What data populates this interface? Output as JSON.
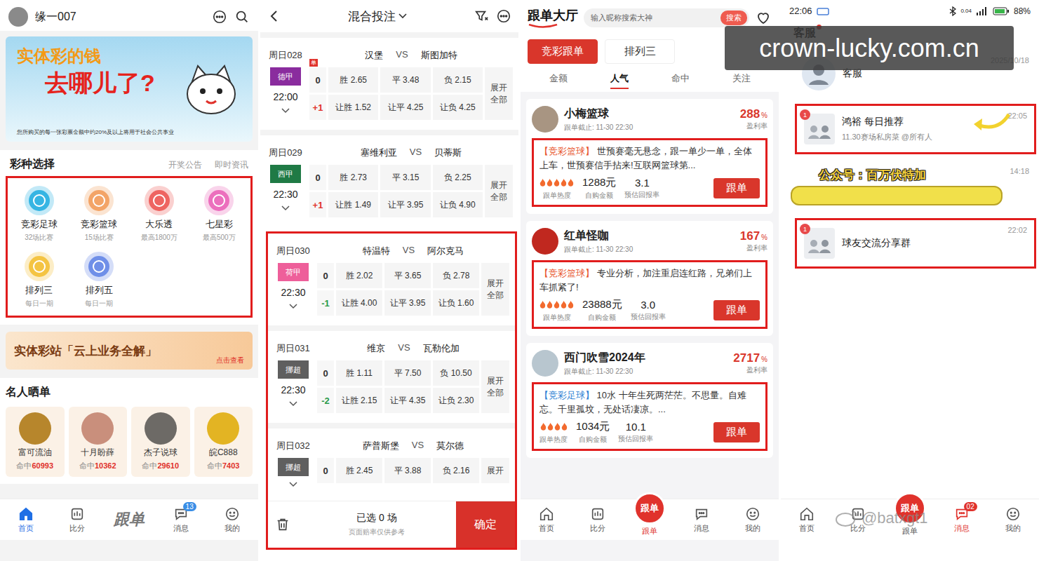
{
  "home": {
    "user": "缘一007",
    "banner": {
      "title1": "实体彩的钱",
      "title2": "去哪儿了?",
      "caption": "您所购买的每一张彩票金额中约20%及以上将用于社会公共事业"
    },
    "lottery": {
      "title": "彩种选择",
      "links": [
        "开奖公告",
        "即时资讯"
      ],
      "boxed": true,
      "items": [
        {
          "name": "竞彩足球",
          "sub": "32场比赛",
          "color": "#36b5e3"
        },
        {
          "name": "竞彩篮球",
          "sub": "15场比赛",
          "color": "#f3a467"
        },
        {
          "name": "大乐透",
          "sub": "最高1800万",
          "color": "#ee6461"
        },
        {
          "name": "七星彩",
          "sub": "最高500万",
          "color": "#ec6fbd"
        },
        {
          "name": "排列三",
          "sub": "每日一期",
          "color": "#f4c443"
        },
        {
          "name": "排列五",
          "sub": "每日一期",
          "color": "#6f8fe8"
        }
      ]
    },
    "promo": {
      "title": "实体彩站「云上业务全解」",
      "link": "点击查看"
    },
    "celebs": {
      "title": "名人晒单",
      "items": [
        {
          "name": "富可流油",
          "hits_label": "命中",
          "hits": "60993",
          "color": "#b7862c"
        },
        {
          "name": "十月盼薛",
          "hits_label": "命中",
          "hits": "10362",
          "color": "#c98f7c"
        },
        {
          "name": "杰子说球",
          "hits_label": "命中",
          "hits": "29610",
          "color": "#6d6a66"
        },
        {
          "name": "皖C888",
          "hits_label": "命中",
          "hits": "7403",
          "color": "#e3b423"
        }
      ]
    },
    "nav": [
      {
        "kind": "home",
        "label": "首页",
        "selected": true
      },
      {
        "kind": "score",
        "label": "比分",
        "selected": false
      },
      {
        "kind": "center-plain",
        "logo": "跟单",
        "selected": false
      },
      {
        "kind": "message",
        "label": "消息",
        "badge": "13",
        "selected": false
      },
      {
        "kind": "me",
        "label": "我的",
        "selected": false
      }
    ]
  },
  "betting": {
    "title": "混合投注",
    "matches": [
      {
        "code": "周日028",
        "league": "德甲",
        "color": "#8a2c9e",
        "time": "22:00",
        "home": "汉堡",
        "vs": "VS",
        "away": "斯图加特",
        "single": "单",
        "boxed": false,
        "expand": "展开全部",
        "rows": [
          {
            "handicap": "0",
            "odds": [
              "胜 2.65",
              "平 3.48",
              "负 2.15"
            ]
          },
          {
            "handicap": "+1",
            "odds": [
              "让胜 1.52",
              "让平 4.25",
              "让负 4.25"
            ]
          }
        ]
      },
      {
        "code": "周日029",
        "league": "西甲",
        "color": "#1f7a45",
        "time": "22:30",
        "home": "塞维利亚",
        "vs": "VS",
        "away": "贝蒂斯",
        "boxed": false,
        "expand": "展开全部",
        "rows": [
          {
            "handicap": "0",
            "odds": [
              "胜 2.73",
              "平 3.15",
              "负 2.25"
            ]
          },
          {
            "handicap": "+1",
            "odds": [
              "让胜 1.49",
              "让平 3.95",
              "让负 4.90"
            ]
          }
        ]
      },
      {
        "code": "周日030",
        "league": "荷甲",
        "color": "#ee5f9a",
        "time": "22:30",
        "home": "特温特",
        "vs": "VS",
        "away": "阿尔克马",
        "boxed": true,
        "expand": "展开全部",
        "rows": [
          {
            "handicap": "0",
            "odds": [
              "胜 2.02",
              "平 3.65",
              "负 2.78"
            ]
          },
          {
            "handicap": "-1",
            "odds": [
              "让胜 4.00",
              "让平 3.95",
              "让负 1.60"
            ]
          }
        ]
      },
      {
        "code": "周日031",
        "league": "挪超",
        "color": "#5f5f5f",
        "time": "22:30",
        "home": "维京",
        "vs": "VS",
        "away": "瓦勒伦加",
        "boxed": true,
        "expand": "展开全部",
        "rows": [
          {
            "handicap": "0",
            "odds": [
              "胜 1.11",
              "平 7.50",
              "负 10.50"
            ]
          },
          {
            "handicap": "-2",
            "odds": [
              "让胜 2.15",
              "让平 4.35",
              "让负 2.30"
            ]
          }
        ]
      },
      {
        "code": "周日032",
        "league": "挪超",
        "color": "#5f5f5f",
        "time": "",
        "home": "萨普斯堡",
        "vs": "VS",
        "away": "莫尔德",
        "boxed": true,
        "expand": "展开",
        "rows": [
          {
            "handicap": "0",
            "odds": [
              "胜 2.45",
              "平 3.88",
              "负 2.16"
            ]
          }
        ]
      }
    ],
    "footer": {
      "selected_text": "已选 0 场",
      "note": "页面赔率仅供参考",
      "confirm": "确定"
    }
  },
  "follow": {
    "logo": "跟单大厅",
    "search_placeholder": "输入昵称搜索大神",
    "search_button": "搜索",
    "tabs": [
      {
        "label": "竞彩跟单",
        "selected": true
      },
      {
        "label": "排列三",
        "selected": false
      }
    ],
    "sorts": [
      {
        "label": "金额",
        "selected": false
      },
      {
        "label": "人气",
        "selected": true
      },
      {
        "label": "命中",
        "selected": false
      },
      {
        "label": "关注",
        "selected": false
      }
    ],
    "cards": [
      {
        "name": "小梅篮球",
        "deadline": "跟单截止: 11-30 22:30",
        "rate": "288",
        "rate_unit": "%",
        "rate_label": "盈利率",
        "tag": "【竞彩篮球】",
        "color": "#e8542b",
        "text": "世预赛毫无悬念，跟一单少一单，全体上车，世预赛信手拈来!互联网篮球第...",
        "stars": 5,
        "heat_label": "跟单热度",
        "amount": "1288元",
        "amount_label": "自购金额",
        "ret": "3.1",
        "ret_label": "预估回报率",
        "button": "跟单",
        "boxed": true,
        "avatar": "#a89582"
      },
      {
        "name": "红单怪咖",
        "deadline": "跟单截止: 11-30 22:30",
        "rate": "167",
        "rate_unit": "%",
        "rate_label": "盈利率",
        "tag": "【竞彩篮球】",
        "color": "#e8542b",
        "text": "专业分析，加注重启连红路，兄弟们上车抓紧了!",
        "stars": 5,
        "heat_label": "跟单热度",
        "amount": "23888元",
        "amount_label": "自购金额",
        "ret": "3.0",
        "ret_label": "预估回报率",
        "button": "跟单",
        "boxed": true,
        "avatar": "#c0281f"
      },
      {
        "name": "西门吹雪2024年",
        "deadline": "跟单截止: 11-30 22:30",
        "rate": "2717",
        "rate_unit": "%",
        "rate_label": "盈利率",
        "tag": "【竞彩足球】",
        "color": "#2c7fd4",
        "text": "10水 十年生死两茫茫。不思量。自难忘。千里孤坟，无处话凄凉。...",
        "stars": 4,
        "heat_label": "跟单热度",
        "amount": "1034元",
        "amount_label": "自购金额",
        "ret": "10.1",
        "ret_label": "预估回报率",
        "button": "跟单",
        "boxed": true,
        "avatar": "#b8c6cf"
      }
    ],
    "nav": [
      {
        "kind": "home",
        "label": "首页",
        "selected": false
      },
      {
        "kind": "score",
        "label": "比分",
        "selected": false
      },
      {
        "kind": "center",
        "logo": "跟单",
        "label": "跟单",
        "selected": true
      },
      {
        "kind": "message",
        "label": "消息",
        "selected": false
      },
      {
        "kind": "me",
        "label": "我的",
        "selected": false
      }
    ]
  },
  "messages": {
    "status": {
      "time": "22:06",
      "net": "0.04",
      "battery": "88%"
    },
    "tabs": [
      {
        "label": "客服",
        "selected": true,
        "dot": true
      }
    ],
    "items": [
      {
        "kind": "service",
        "name": "客服",
        "time": "2025/10/18",
        "boxed": false
      },
      {
        "kind": "group",
        "name": "鸿裕 每日推荐",
        "preview": "11.30赛场私房菜 @所有人",
        "time": "22:05",
        "unread": "1",
        "boxed": true,
        "arrow": true
      },
      {
        "kind": "obscured",
        "overlay": "公众号：百万伏特加",
        "time": "14:18",
        "boxed": false
      },
      {
        "kind": "group",
        "name": "球友交流分享群",
        "time": "22:02",
        "unread": "1",
        "boxed": true
      }
    ],
    "nav": [
      {
        "kind": "home",
        "label": "首页",
        "selected": false
      },
      {
        "kind": "score",
        "label": "比分",
        "selected": false
      },
      {
        "kind": "center",
        "logo": "跟单",
        "label": "跟单",
        "selected": false
      },
      {
        "kind": "message",
        "label": "消息",
        "badge": "02",
        "selected": true
      },
      {
        "kind": "me",
        "label": "我的",
        "selected": false
      }
    ]
  },
  "watermarks": {
    "top": "crown-lucky.com.cn",
    "bottom": "@batxgt1"
  }
}
